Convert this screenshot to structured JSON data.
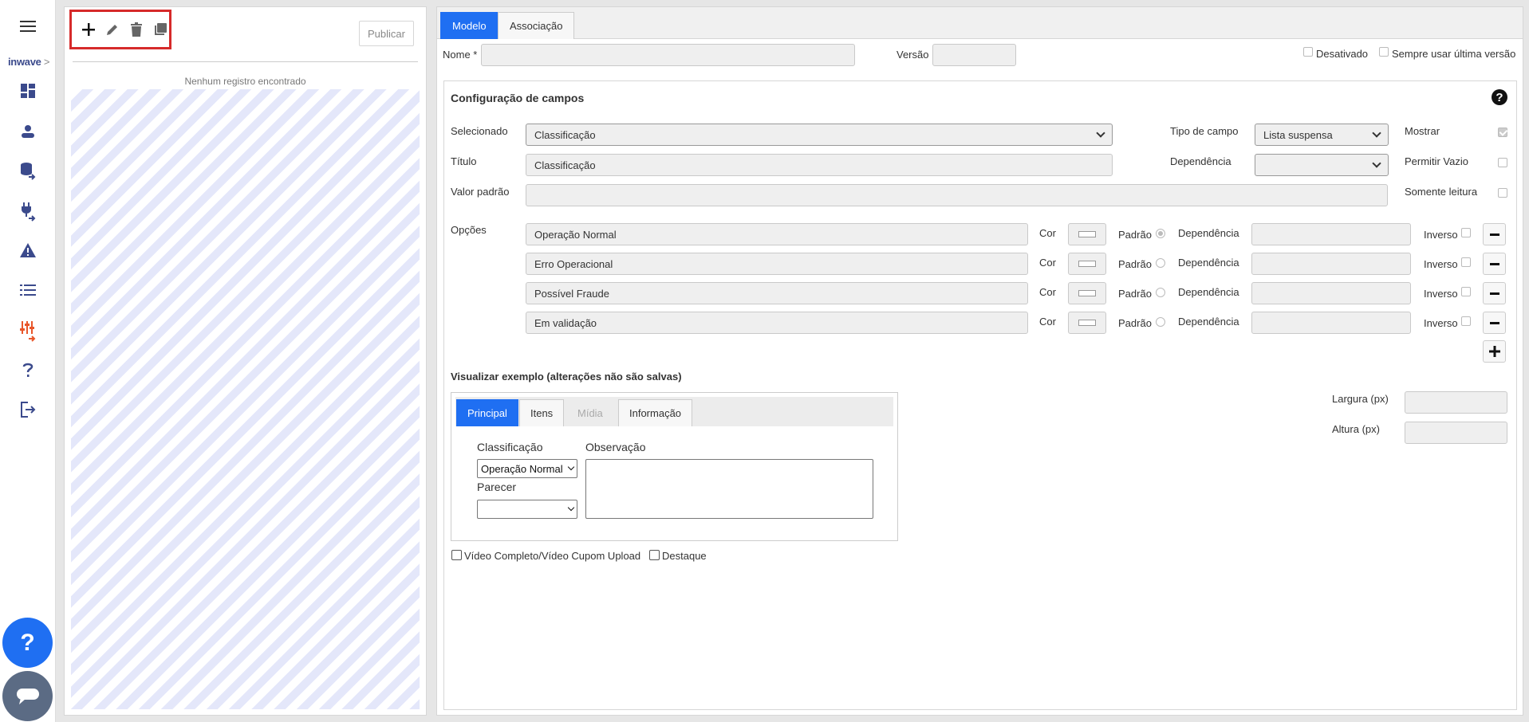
{
  "brand": {
    "name": "inwave",
    "arrow": ">"
  },
  "list": {
    "publish_label": "Publicar",
    "empty_message": "Nenhum registro encontrado"
  },
  "form": {
    "tabs": [
      {
        "label": "Modelo"
      },
      {
        "label": "Associação"
      }
    ],
    "name_label": "Nome *",
    "name_value": "",
    "version_label": "Versão",
    "version_value": "",
    "disabled_label": "Desativado",
    "always_latest_label": "Sempre usar última versão",
    "config": {
      "title": "Configuração de campos",
      "selected_label": "Selecionado",
      "selected_value": "Classificação",
      "field_type_label": "Tipo de campo",
      "field_type_value": "Lista suspensa",
      "show_label": "Mostrar",
      "title_label": "Título",
      "title_value": "Classificação",
      "dependency_label": "Dependência",
      "dependency_value": "",
      "allow_empty_label": "Permitir Vazio",
      "default_value_label": "Valor padrão",
      "default_value": "",
      "readonly_label": "Somente leitura",
      "options_label": "Opções",
      "color_label": "Cor",
      "default_label": "Padrão",
      "option_dependency_label": "Dependência",
      "inverse_label": "Inverso",
      "options": [
        {
          "value": "Operação Normal",
          "default": true
        },
        {
          "value": "Erro Operacional",
          "default": false
        },
        {
          "value": "Possível Fraude",
          "default": false
        },
        {
          "value": "Em validação",
          "default": false
        }
      ]
    },
    "preview": {
      "title": "Visualizar exemplo (alterações não são salvas)",
      "tabs": [
        {
          "label": "Principal",
          "state": "active"
        },
        {
          "label": "Itens",
          "state": "normal"
        },
        {
          "label": "Mídia",
          "state": "disabled"
        },
        {
          "label": "Informação",
          "state": "normal"
        }
      ],
      "classification_label": "Classificação",
      "classification_value": "Operação Normal",
      "observation_label": "Observação",
      "opinion_label": "Parecer",
      "opinion_value": ""
    },
    "width_label": "Largura (px)",
    "height_label": "Altura (px)",
    "video_label": "Vídeo Completo/Vídeo Cupom Upload",
    "highlight_label": "Destaque"
  }
}
